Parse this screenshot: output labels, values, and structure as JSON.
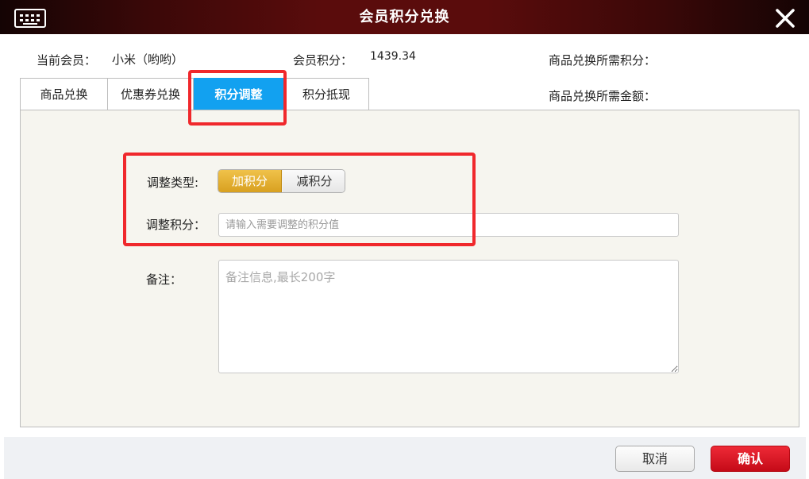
{
  "window": {
    "title": "会员积分兑换"
  },
  "info": {
    "member_label": "当前会员：",
    "member_value": "小米（哟哟）",
    "points_label": "会员积分：",
    "points_value": "1439.34",
    "required_points_label": "商品兑换所需积分：",
    "required_amount_label": "商品兑换所需金额："
  },
  "tabs": [
    {
      "label": "商品兑换",
      "active": false
    },
    {
      "label": "优惠券兑换",
      "active": false
    },
    {
      "label": "积分调整",
      "active": true
    },
    {
      "label": "积分抵现",
      "active": false
    }
  ],
  "form": {
    "type_label": "调整类型:",
    "type_options": [
      {
        "label": "加积分",
        "selected": true
      },
      {
        "label": "减积分",
        "selected": false
      }
    ],
    "points_label": "调整积分：",
    "points_placeholder": "请输入需要调整的积分值",
    "points_value": "",
    "remark_label": "备注：",
    "remark_placeholder": "备注信息,最长200字",
    "remark_value": ""
  },
  "buttons": {
    "cancel": "取消",
    "confirm": "确认"
  },
  "colors": {
    "titlebar": "#5a0c0c",
    "tab_active": "#12a1f0",
    "toggle_on": "#e0aa2a",
    "confirm": "#d8101e",
    "highlight": "#f0282c",
    "panel_bg": "#f6f5ef"
  },
  "icons": {
    "app": "keyboard-icon",
    "close": "close-icon"
  }
}
